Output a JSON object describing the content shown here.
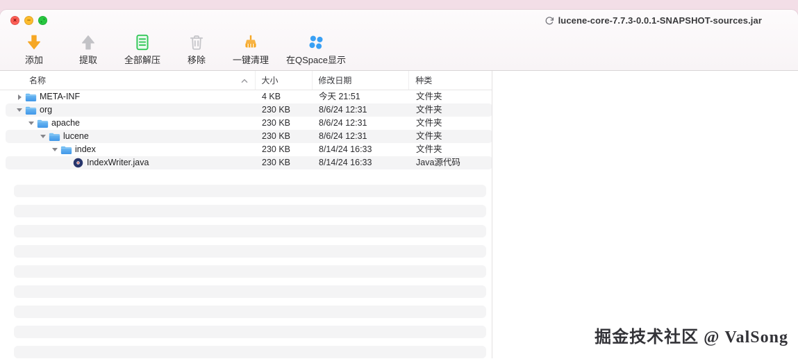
{
  "window": {
    "title": "lucene-core-7.7.3-0.0.1-SNAPSHOT-sources.jar",
    "proxy_icon": "sync-arrow-icon",
    "traffic_lights": [
      {
        "name": "close",
        "color": "#ff5f57",
        "glyph": "×"
      },
      {
        "name": "minimize",
        "color": "#febc2e",
        "glyph": "−"
      },
      {
        "name": "zoom",
        "color": "#28c840",
        "glyph": "diagonal-arrows"
      }
    ]
  },
  "toolbar": {
    "buttons": [
      {
        "name": "add",
        "label": "添加",
        "icon": "add-down-arrow-icon",
        "color": "#f6a724"
      },
      {
        "name": "extract",
        "label": "提取",
        "icon": "extract-up-arrow-icon",
        "color": "#c2c2c6"
      },
      {
        "name": "extract-all",
        "label": "全部解压",
        "icon": "unzip-document-icon",
        "color": "#34c759"
      },
      {
        "name": "remove",
        "label": "移除",
        "icon": "trash-icon",
        "color": "#c6c6ca"
      },
      {
        "name": "clean",
        "label": "一键清理",
        "icon": "clean-brush-icon",
        "color": "#f6a724"
      },
      {
        "name": "show-in-qspace",
        "label": "在QSpace显示",
        "icon": "qspace-flower-icon",
        "color": "#39a0f4"
      }
    ]
  },
  "table": {
    "columns": [
      {
        "id": "name",
        "label": "名称",
        "sort": "asc"
      },
      {
        "id": "size",
        "label": "大小",
        "sort": ""
      },
      {
        "id": "date",
        "label": "修改日期",
        "sort": ""
      },
      {
        "id": "kind",
        "label": "种类",
        "sort": ""
      }
    ],
    "rows": [
      {
        "name": "META-INF",
        "indent": 0,
        "disclosure": "collapsed",
        "icon": "folder-icon",
        "size": "4 KB",
        "date": "今天 21:51",
        "kind": "文件夹"
      },
      {
        "name": "org",
        "indent": 0,
        "disclosure": "expanded",
        "icon": "folder-icon",
        "size": "230 KB",
        "date": "8/6/24 12:31",
        "kind": "文件夹"
      },
      {
        "name": "apache",
        "indent": 1,
        "disclosure": "expanded",
        "icon": "folder-icon",
        "size": "230 KB",
        "date": "8/6/24 12:31",
        "kind": "文件夹"
      },
      {
        "name": "lucene",
        "indent": 2,
        "disclosure": "expanded",
        "icon": "folder-icon",
        "size": "230 KB",
        "date": "8/6/24 12:31",
        "kind": "文件夹"
      },
      {
        "name": "index",
        "indent": 3,
        "disclosure": "expanded",
        "icon": "folder-icon",
        "size": "230 KB",
        "date": "8/14/24 16:33",
        "kind": "文件夹"
      },
      {
        "name": "IndexWriter.java",
        "indent": 4,
        "disclosure": "none",
        "icon": "java-file-icon",
        "size": "230 KB",
        "date": "8/14/24 16:33",
        "kind": "Java源代码"
      }
    ],
    "empty_stripe_count": 9
  },
  "watermark": "掘金技术社区 @ ValSong",
  "colors": {
    "row_stripe": "#f4f4f5",
    "folder_blue": "#4197e8",
    "desktop_pink": "#f3dee7",
    "divider": "#e2e0e1"
  }
}
